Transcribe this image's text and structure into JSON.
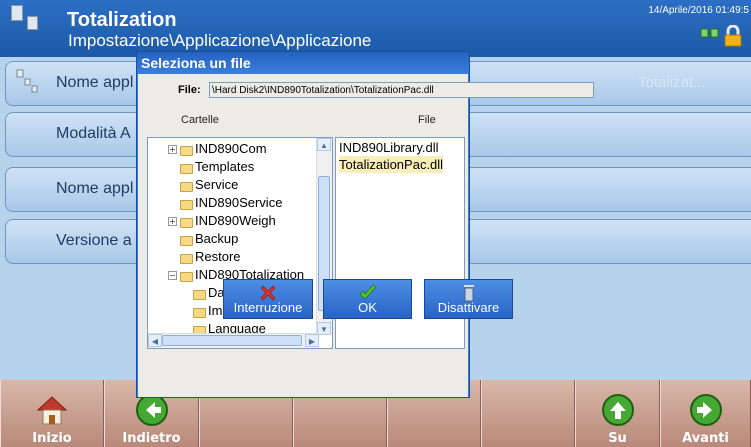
{
  "header": {
    "title": "Totalization",
    "path": "Impostazione\\Applicazione\\Applicazione",
    "datetime": "14/Aprile/2016 01:49:5"
  },
  "list": {
    "rows": [
      {
        "label": "Nome appl",
        "value": "Totalizat..."
      },
      {
        "label": "Modalità A",
        "value": ""
      },
      {
        "label": "Nome appl",
        "value": ""
      },
      {
        "label": "Versione a",
        "value": ""
      }
    ]
  },
  "dialog": {
    "title": "Seleziona un file",
    "file_label": "File:",
    "file_value": "\\Hard Disk2\\IND890Totalization\\TotalizationPac.dll",
    "folders_header": "Cartelle",
    "files_header": "File",
    "folders": [
      {
        "name": "IND890Com",
        "expander": "+"
      },
      {
        "name": "Templates",
        "expander": ""
      },
      {
        "name": "Service",
        "expander": ""
      },
      {
        "name": "IND890Service",
        "expander": ""
      },
      {
        "name": "IND890Weigh",
        "expander": "+"
      },
      {
        "name": "Backup",
        "expander": ""
      },
      {
        "name": "Restore",
        "expander": ""
      },
      {
        "name": "IND890Totalization",
        "expander": "−"
      },
      {
        "name": "Data",
        "expander": ""
      },
      {
        "name": "Images",
        "expander": ""
      },
      {
        "name": "Language",
        "expander": ""
      }
    ],
    "files": [
      {
        "name": "IND890Library.dll",
        "selected": false
      },
      {
        "name": "TotalizationPac.dll",
        "selected": true
      }
    ],
    "buttons": {
      "cancel": "Interruzione",
      "ok": "OK",
      "disable": "Disattivare"
    }
  },
  "softkeys": {
    "home": "Inizio",
    "back": "Indietro",
    "up": "Su",
    "next": "Avanti"
  },
  "colors": {
    "header_blue": "#1f5fb0",
    "dialog_blue": "#3a7bd5",
    "softkey_bg": "#c89e8f",
    "selection": "#f8eeb8"
  }
}
